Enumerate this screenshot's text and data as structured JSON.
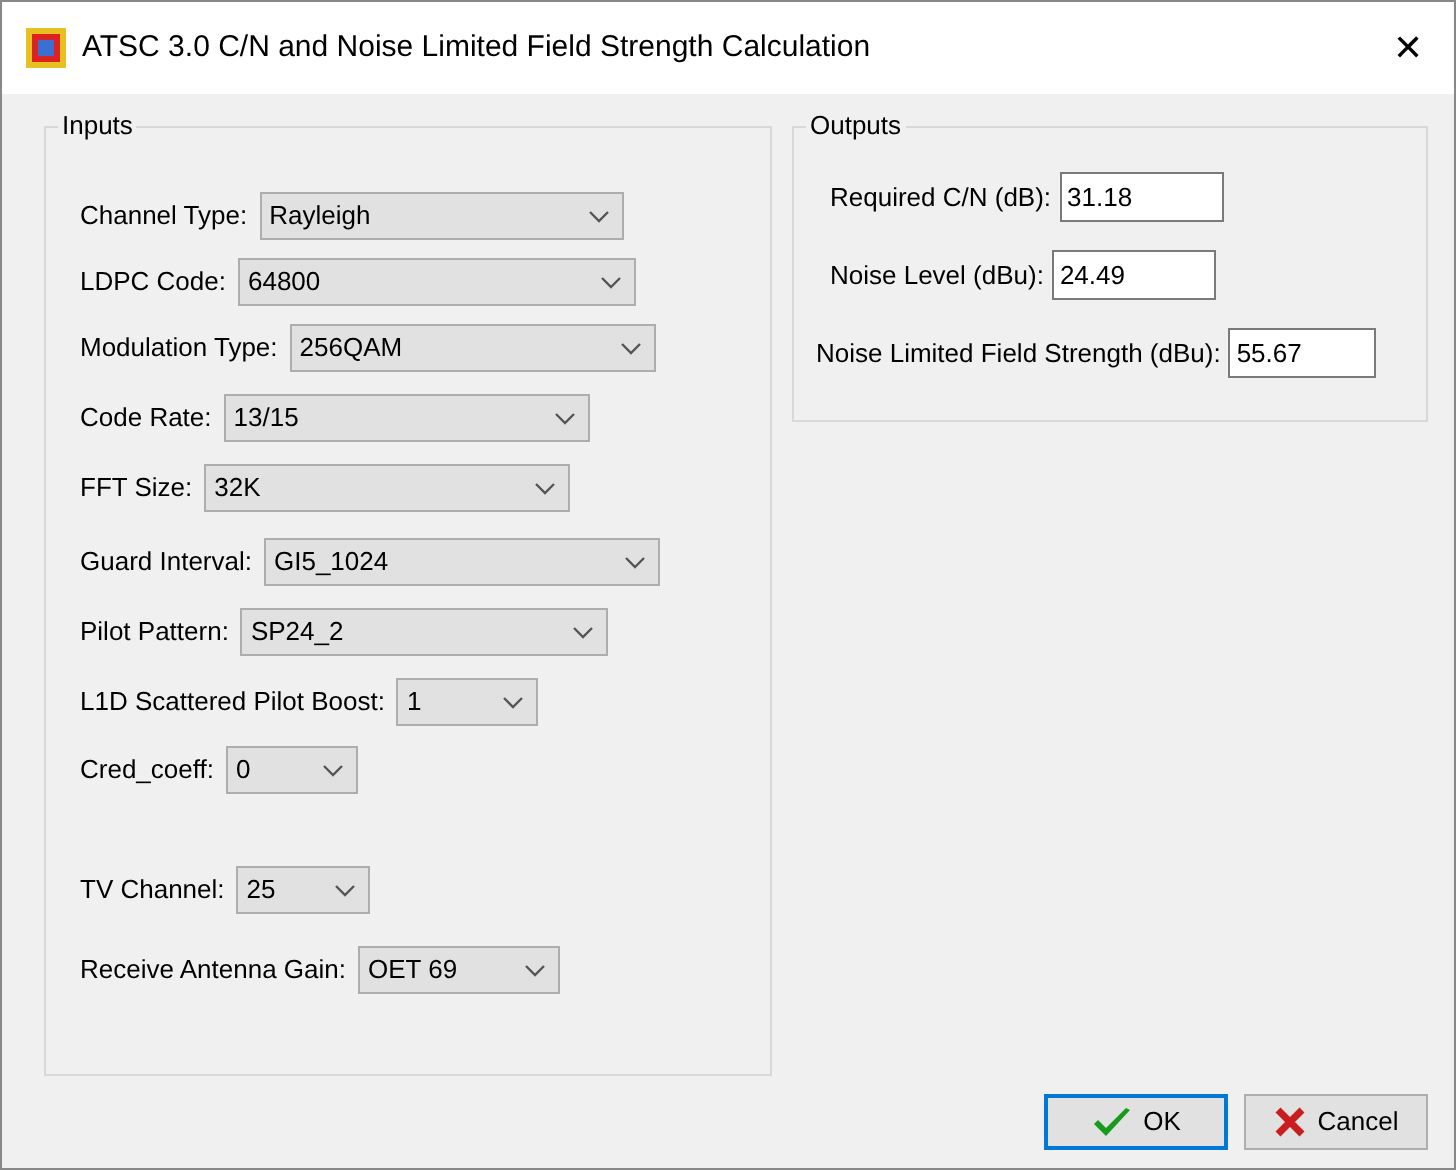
{
  "window": {
    "title": "ATSC 3.0 C/N and Noise Limited Field Strength Calculation",
    "close": "✕"
  },
  "inputs": {
    "title": "Inputs",
    "fields": [
      {
        "label": "Channel Type:",
        "value": "Rayleigh"
      },
      {
        "label": "LDPC Code:",
        "value": "64800"
      },
      {
        "label": "Modulation Type:",
        "value": "256QAM"
      },
      {
        "label": "Code Rate:",
        "value": "13/15"
      },
      {
        "label": "FFT Size:",
        "value": "32K"
      },
      {
        "label": "Guard Interval:",
        "value": "GI5_1024"
      },
      {
        "label": "Pilot Pattern:",
        "value": "SP24_2"
      },
      {
        "label": "L1D Scattered Pilot Boost:",
        "value": "1"
      },
      {
        "label": "Cred_coeff:",
        "value": "0"
      },
      {
        "label": "TV Channel:",
        "value": "25"
      },
      {
        "label": "Receive Antenna Gain:",
        "value": "OET 69"
      }
    ]
  },
  "outputs": {
    "title": "Outputs",
    "fields": [
      {
        "label": "Required C/N (dB):",
        "value": "31.18"
      },
      {
        "label": "Noise Level (dBu):",
        "value": "24.49"
      },
      {
        "label": "Noise Limited Field Strength (dBu):",
        "value": "55.67"
      }
    ]
  },
  "buttons": [
    {
      "kind": "ok",
      "label": "OK",
      "selected": true
    },
    {
      "kind": "cancel",
      "label": "Cancel",
      "selected": false
    }
  ]
}
